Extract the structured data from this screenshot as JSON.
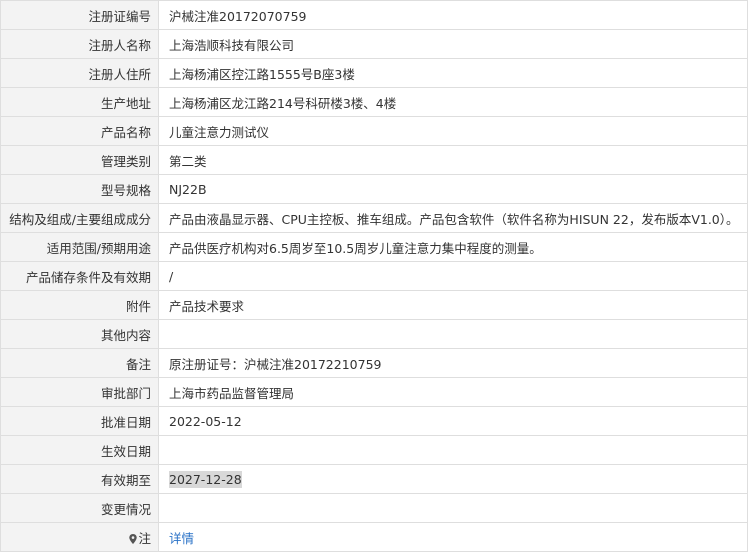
{
  "rows": [
    {
      "label": "注册证编号",
      "value": "沪械注准20172070759"
    },
    {
      "label": "注册人名称",
      "value": "上海浩顺科技有限公司"
    },
    {
      "label": "注册人住所",
      "value": "上海杨浦区控江路1555号B座3楼"
    },
    {
      "label": "生产地址",
      "value": "上海杨浦区龙江路214号科研楼3楼、4楼"
    },
    {
      "label": "产品名称",
      "value": "儿童注意力测试仪"
    },
    {
      "label": "管理类别",
      "value": "第二类"
    },
    {
      "label": "型号规格",
      "value": "NJ22B"
    },
    {
      "label": "结构及组成/主要组成成分",
      "value": "产品由液晶显示器、CPU主控板、推车组成。产品包含软件（软件名称为HISUN 22，发布版本V1.0）。"
    },
    {
      "label": "适用范围/预期用途",
      "value": "产品供医疗机构对6.5周岁至10.5周岁儿童注意力集中程度的测量。"
    },
    {
      "label": "产品储存条件及有效期",
      "value": "/"
    },
    {
      "label": "附件",
      "value": "产品技术要求"
    },
    {
      "label": "其他内容",
      "value": ""
    },
    {
      "label": "备注",
      "value": "原注册证号：沪械注准20172210759"
    },
    {
      "label": "审批部门",
      "value": "上海市药品监督管理局"
    },
    {
      "label": "批准日期",
      "value": "2022-05-12"
    },
    {
      "label": "生效日期",
      "value": ""
    },
    {
      "label": "有效期至",
      "value": "2027-12-28"
    },
    {
      "label": "变更情况",
      "value": ""
    }
  ],
  "note": {
    "label": "注",
    "link": "详情",
    "icon": "pin-icon"
  }
}
